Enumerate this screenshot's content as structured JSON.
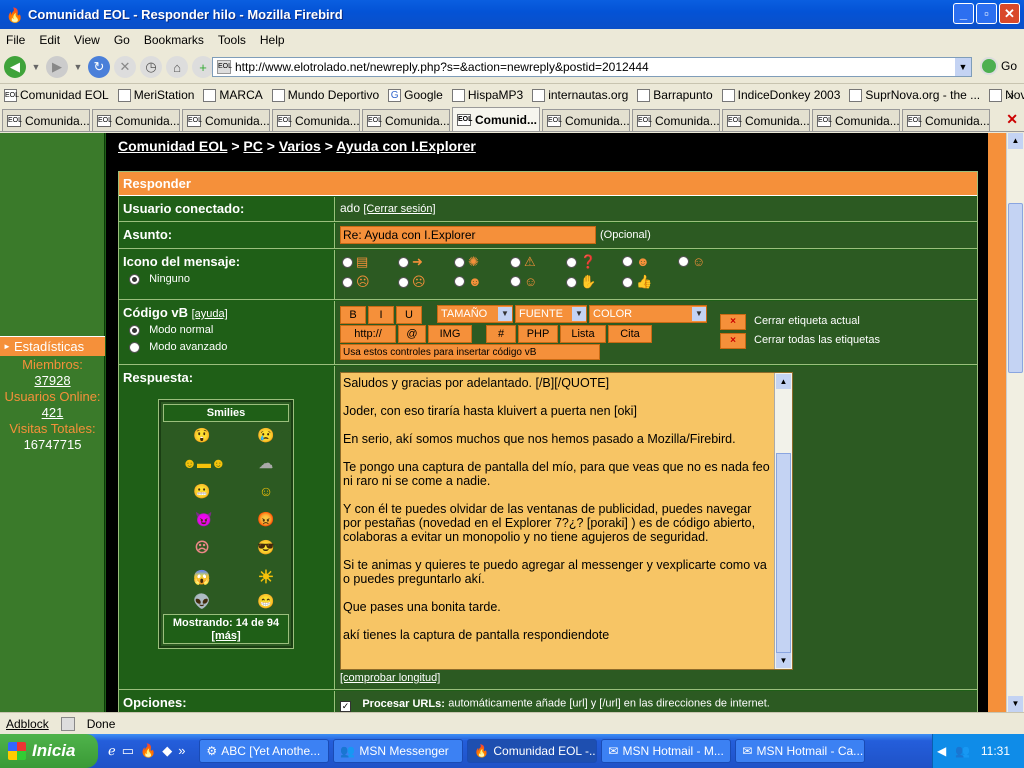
{
  "window": {
    "title": "Comunidad EOL - Responder hilo - Mozilla Firebird"
  },
  "menu": [
    "File",
    "Edit",
    "View",
    "Go",
    "Bookmarks",
    "Tools",
    "Help"
  ],
  "nav": {
    "url": "http://www.elotrolado.net/newreply.php?s=&action=newreply&postid=2012444",
    "go_label": "Go"
  },
  "bookmarks": [
    "Comunidad EOL",
    "MeriStation",
    "MARCA",
    "Mundo Deportivo",
    "Google",
    "HispaMP3",
    "internautas.org",
    "Barrapunto",
    "IndiceDonkey 2003",
    "SuprNova.org - the ...",
    "NovaSearch"
  ],
  "tabs": [
    "Comunida...",
    "Comunida...",
    "Comunida...",
    "Comunida...",
    "Comunida...",
    "Comunid...",
    "Comunida...",
    "Comunida...",
    "Comunida...",
    "Comunida...",
    "Comunida..."
  ],
  "tab_favicon": "EOL",
  "sidebar": {
    "stats_title": "Estadísticas",
    "members_label": "Miembros:",
    "members_value": "37928",
    "online_label": "Usuarios Online:",
    "online_value": "421",
    "visits_label": "Visitas Totales:",
    "visits_value": "16747715"
  },
  "breadcrumb": {
    "items": [
      "Comunidad EOL",
      "PC",
      "Varios",
      "Ayuda con I.Explorer"
    ],
    "sep": ">"
  },
  "form": {
    "header": "Responder",
    "user_label": "Usuario conectado:",
    "user_value": "ado",
    "logout": "[Cerrar sesión]",
    "subject_label": "Asunto:",
    "subject_value": "Re: Ayuda con I.Explorer",
    "subject_optional": "(Opcional)",
    "icon_label": "Icono del mensaje:",
    "icon_none": "Ninguno",
    "vb_label": "Código vB",
    "vb_help": "[ayuda]",
    "mode_normal": "Modo normal",
    "mode_advanced": "Modo avanzado",
    "btn_b": "B",
    "btn_i": "I",
    "btn_u": "U",
    "sel_size": "TAMAÑO",
    "sel_font": "FUENTE",
    "sel_color": "COLOR",
    "btn_http": "http://",
    "btn_at": "@",
    "btn_img": "IMG",
    "btn_hash": "#",
    "btn_php": "PHP",
    "btn_list": "Lista",
    "btn_quote": "Cita",
    "vb_hint": "Usa estos controles para insertar código vB",
    "close_current": "Cerrar etiqueta actual",
    "close_all": "Cerrar todas las etiquetas",
    "reply_label": "Respuesta:",
    "message": [
      "Saludos y gracias por adelantado. [/B][/QUOTE]",
      "Joder, con eso tiraría hasta kluivert a puerta nen  [oki]",
      "En serio, akí somos muchos que nos hemos pasado a Mozilla/Firebird.",
      "Te pongo una captura de pantalla del mío, para que veas que no es nada feo ni raro ni se come a nadie.",
      "Y con él te puedes olvidar de las ventanas de publicidad, puedes navegar por pestañas (novedad en el Explorer 7?¿? [poraki] ) es de código abierto, colaboras a evitar un monopolio y no tiene agujeros de seguridad.",
      "Si te animas y quieres te puedo agregar al messenger y vexplicarte como va o puedes preguntarlo akí.",
      "Que pases una bonita tarde.",
      "akí tienes la captura de pantalla respondiendote"
    ],
    "check_length": "[comprobar longitud]",
    "options_label": "Opciones:",
    "process_urls_bold": "Procesar URLs:",
    "process_urls_text": "automáticamente añade [url] y [/url] en las direcciones de internet."
  },
  "smilies": {
    "title": "Smilies",
    "showing": "Mostrando: 14 de 94",
    "more": "[más]"
  },
  "status": {
    "adblock": "Adblock",
    "text": "Done"
  },
  "taskbar": {
    "start": "Inicia",
    "items": [
      "ABC [Yet Anothe...",
      "MSN Messenger",
      "Comunidad EOL -...",
      "MSN Hotmail - M...",
      "MSN Hotmail - Ca..."
    ],
    "clock": "11:31"
  },
  "colors": {
    "accent": "#f5903a",
    "forum_green": "#1f5f17",
    "xp_blue": "#0453d6"
  }
}
